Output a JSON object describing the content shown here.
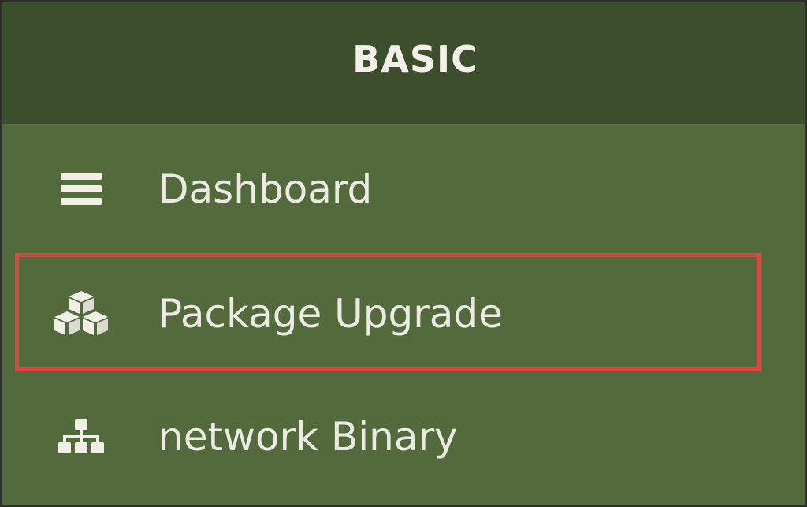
{
  "sidebar": {
    "section_title": "BASIC",
    "items": [
      {
        "label": "Dashboard",
        "icon": "bars-icon"
      },
      {
        "label": "Package Upgrade",
        "icon": "cubes-icon"
      },
      {
        "label": "network Binary",
        "icon": "sitemap-icon"
      }
    ]
  },
  "colors": {
    "header_bg": "#3d4e2c",
    "sidebar_bg": "#536a3c",
    "text": "#ecebe3",
    "highlight": "#d9473e"
  }
}
